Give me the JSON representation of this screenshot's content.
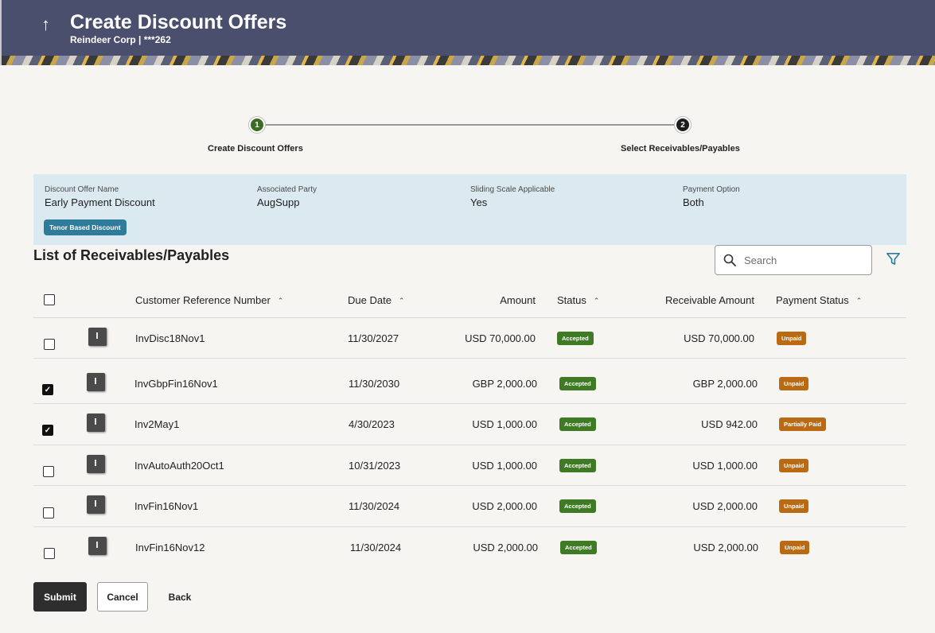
{
  "header": {
    "title": "Create Discount Offers",
    "subtitle": "Reindeer Corp | ***262",
    "back_icon": "↑"
  },
  "stepper": {
    "steps": [
      {
        "number": "1",
        "label": "Create Discount Offers",
        "state": "completed"
      },
      {
        "number": "2",
        "label": "Select Receivables/Payables",
        "state": "active"
      }
    ]
  },
  "summary": {
    "fields": [
      {
        "label": "Discount Offer Name",
        "value": "Early Payment Discount"
      },
      {
        "label": "Associated Party",
        "value": "AugSupp"
      },
      {
        "label": "Sliding Scale Applicable",
        "value": "Yes"
      },
      {
        "label": "Payment Option",
        "value": "Both"
      }
    ],
    "tag": "Tenor Based Discount"
  },
  "list": {
    "title": "List of Receivables/Payables",
    "search_placeholder": "Search",
    "columns": [
      "Customer Reference Number",
      "Due Date",
      "Amount",
      "Status",
      "Receivable Amount",
      "Payment Status"
    ],
    "rows": [
      {
        "checked": false,
        "ref": "InvDisc18Nov1",
        "due": "11/30/2027",
        "amount": "USD 70,000.00",
        "status": "Accepted",
        "receivable": "USD 70,000.00",
        "payment": "Unpaid"
      },
      {
        "checked": true,
        "ref": "InvGbpFin16Nov1",
        "due": "11/30/2030",
        "amount": "GBP 2,000.00",
        "status": "Accepted",
        "receivable": "GBP 2,000.00",
        "payment": "Unpaid"
      },
      {
        "checked": true,
        "ref": "Inv2May1",
        "due": "4/30/2023",
        "amount": "USD 1,000.00",
        "status": "Accepted",
        "receivable": "USD 942.00",
        "payment": "Partially Paid"
      },
      {
        "checked": false,
        "ref": "InvAutoAuth20Oct1",
        "due": "10/31/2023",
        "amount": "USD 1,000.00",
        "status": "Accepted",
        "receivable": "USD 1,000.00",
        "payment": "Unpaid"
      },
      {
        "checked": false,
        "ref": "InvFin16Nov1",
        "due": "11/30/2024",
        "amount": "USD 2,000.00",
        "status": "Accepted",
        "receivable": "USD 2,000.00",
        "payment": "Unpaid"
      },
      {
        "checked": false,
        "ref": "InvFin16Nov12",
        "due": "11/30/2024",
        "amount": "USD 2,000.00",
        "status": "Accepted",
        "receivable": "USD 2,000.00",
        "payment": "Unpaid"
      }
    ]
  },
  "actions": {
    "submit": "Submit",
    "cancel": "Cancel",
    "back": "Back"
  },
  "colors": {
    "header_bg": "#4a4f6d",
    "step_done": "#3d6b21",
    "accepted_badge": "#3f7a24",
    "payment_badge": "#b96a12",
    "tag_bg": "#2f7b9a",
    "summary_bg": "#dbe9f1"
  }
}
